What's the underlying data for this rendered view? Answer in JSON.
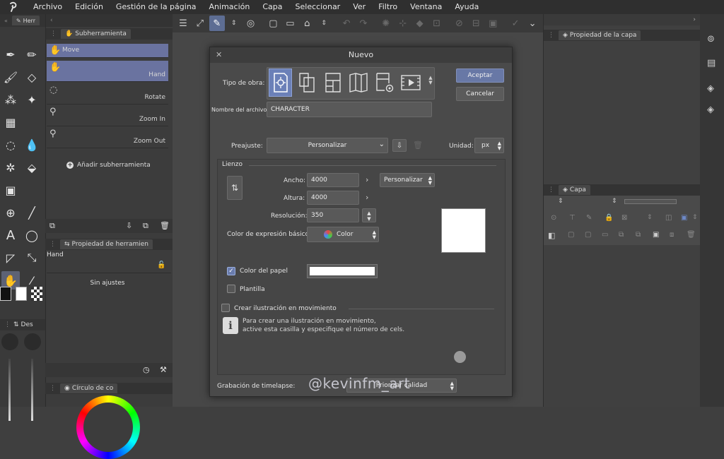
{
  "menubar": {
    "logo_icon": "clip-studio-logo-icon",
    "items": [
      "Archivo",
      "Edición",
      "Gestión de la página",
      "Animación",
      "Capa",
      "Seleccionar",
      "Ver",
      "Filtro",
      "Ventana",
      "Ayuda"
    ]
  },
  "panels": {
    "tool_tab": "Herr",
    "subtool_tab": "Subherramienta",
    "subtools": [
      {
        "label": "Move",
        "icon": "hand-icon"
      },
      {
        "label": "Hand",
        "icon": "hand-icon"
      },
      {
        "label": "Rotate",
        "icon": "rotate-icon"
      },
      {
        "label": "Zoom In",
        "icon": "zoom-in-icon"
      },
      {
        "label": "Zoom Out",
        "icon": "zoom-out-icon"
      }
    ],
    "add_subtool": "Añadir subherramienta",
    "tool_property_tab": "Propiedad de herramien",
    "tool_property_name": "Hand",
    "no_settings": "Sin ajustes",
    "color_wheel_tab": "Círculo de co",
    "brush_size_tab": "Des",
    "layer_property_tab": "Propiedad de la capa",
    "layer_tab": "Capa"
  },
  "dialog": {
    "title": "Nuevo",
    "work_type_label": "Tipo de obra:",
    "filename_label": "Nombre del archivo:",
    "filename_value": "CHARACTER",
    "accept": "Aceptar",
    "cancel": "Cancelar",
    "preset_label": "Preajuste:",
    "preset_value": "Personalizar",
    "unit_label": "Unidad:",
    "unit_value": "px",
    "canvas_group": "Lienzo",
    "width_label": "Ancho:",
    "width_value": "4000",
    "height_label": "Altura:",
    "height_value": "4000",
    "size_preset": "Personalizar",
    "resolution_label": "Resolución:",
    "resolution_value": "350",
    "color_mode_label": "Color de expresión básico:",
    "color_mode_value": "Color",
    "paper_color_label": "Color del papel",
    "paper_color_checked": true,
    "paper_color": "#ffffff",
    "template_label": "Plantilla",
    "template_checked": false,
    "animation_label": "Crear ilustración en movimiento",
    "animation_checked": false,
    "info_line1": "Para crear una ilustración en movimiento,",
    "info_line2": "active esta casilla y especifique el número de cels.",
    "timelapse_label": "Grabación de timelapse:",
    "timelapse_value": "Priorizar calidad"
  },
  "watermark": "@kevinfm_art",
  "colors": {
    "accent": "#6878a6",
    "selection": "#6b80b8",
    "panel_bg": "#3b3b3b",
    "menubar_bg": "#2f2f2f"
  }
}
